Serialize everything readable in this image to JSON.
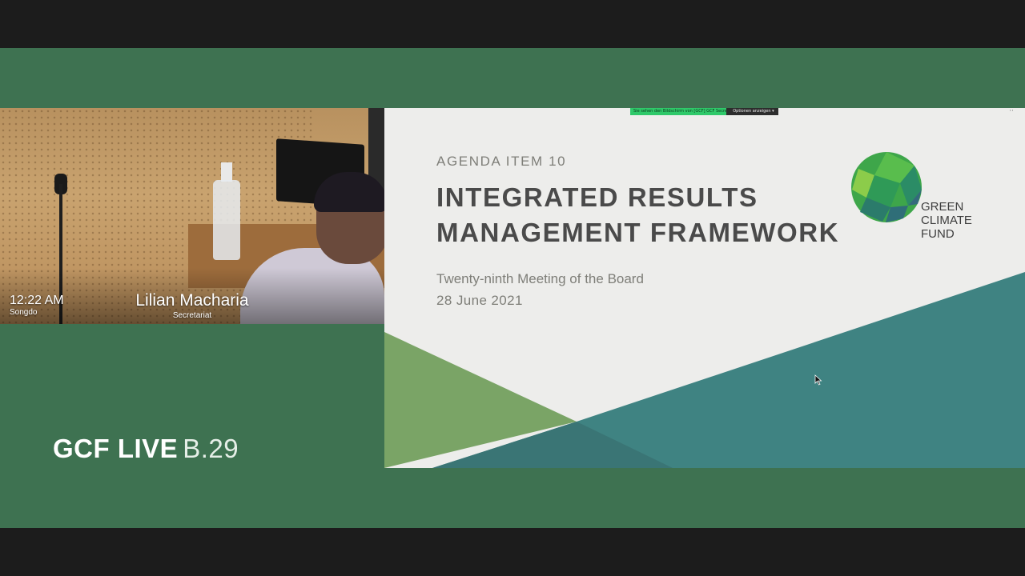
{
  "camera": {
    "time": "12:22 AM",
    "location": "Songdo",
    "speaker_name": "Lilian Macharia",
    "speaker_role": "Secretariat"
  },
  "brand": {
    "main": "GCF LIVE",
    "sub": "B.29"
  },
  "share_toolbar": {
    "status_text": "Sie sehen den Bildschirm von [GCF] GCF Secretariat",
    "options_label": "Optionen anzeigen ▾"
  },
  "slide": {
    "agenda_label": "AGENDA ITEM 10",
    "title_line1": "INTEGRATED RESULTS",
    "title_line2": "MANAGEMENT FRAMEWORK",
    "meeting": "Twenty-ninth Meeting of the Board",
    "date": "28 June 2021",
    "logo_line1": "GREEN",
    "logo_line2": "CLIMATE",
    "logo_line3": "FUND"
  },
  "colors": {
    "frame_green": "#3e7251",
    "slide_teal": "#3f8382",
    "slide_light_green": "#7aa466",
    "slide_background": "#ededeb",
    "share_green": "#2fc96a"
  }
}
